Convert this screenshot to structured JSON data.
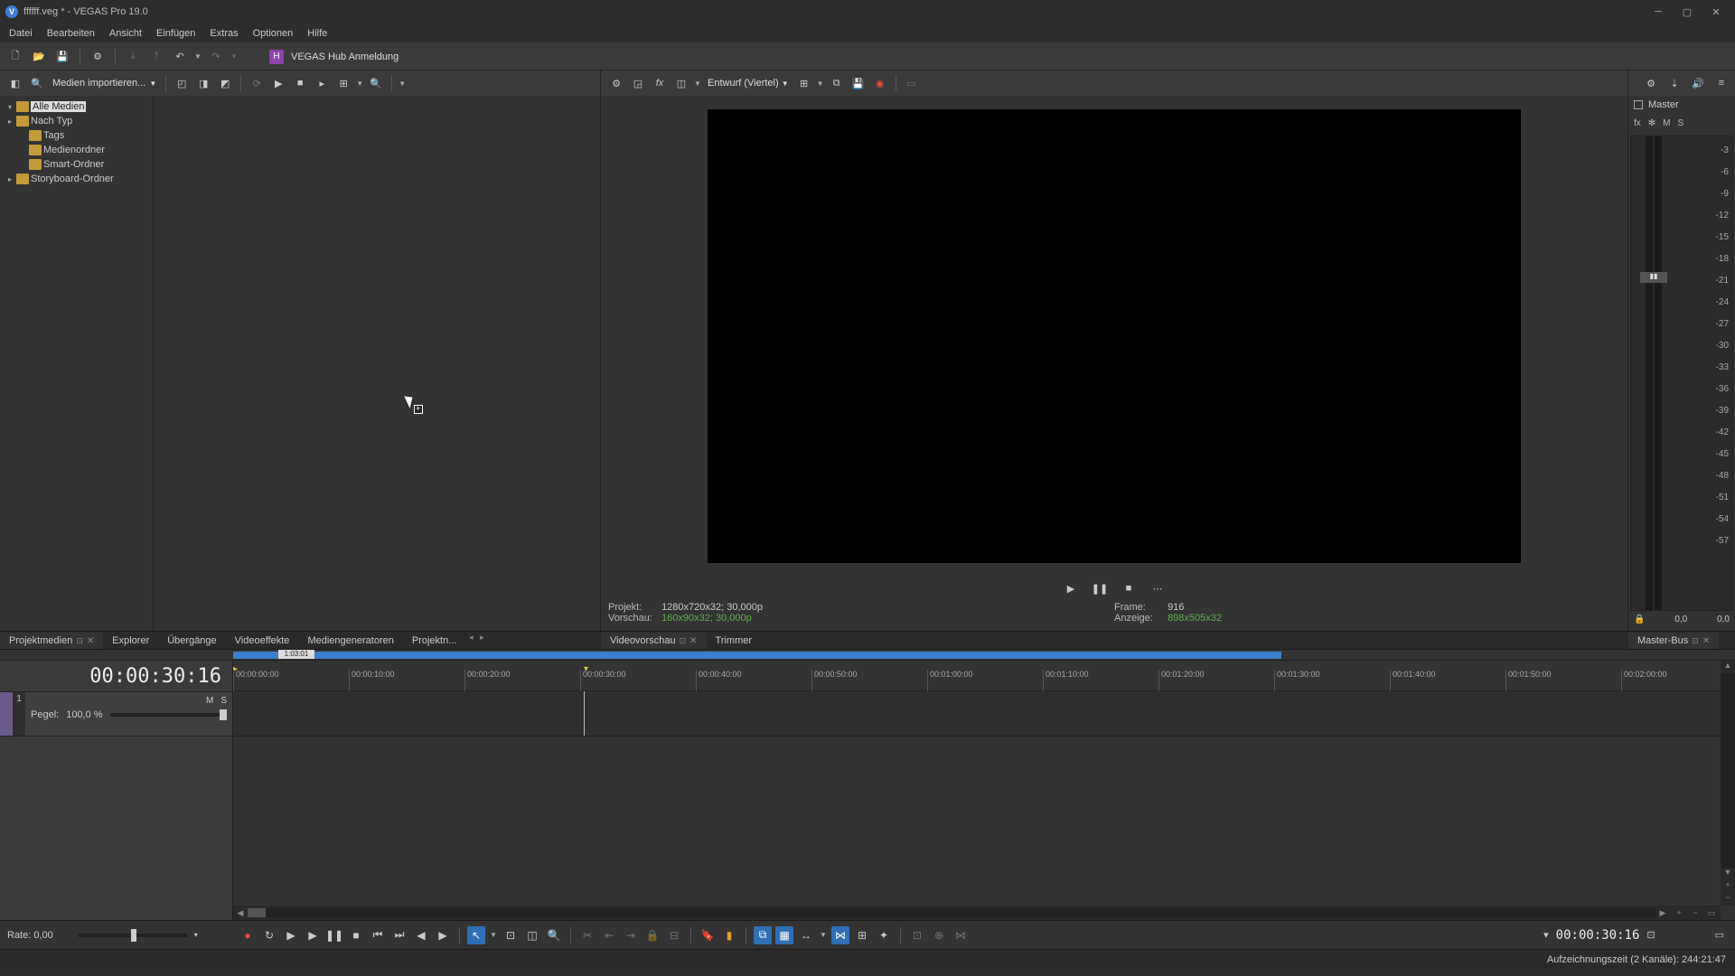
{
  "title": "ffffff.veg * - VEGAS Pro 19.0",
  "menu": [
    "Datei",
    "Bearbeiten",
    "Ansicht",
    "Einfügen",
    "Extras",
    "Optionen",
    "Hilfe"
  ],
  "hub_label": "VEGAS Hub Anmeldung",
  "import_label": "Medien importieren...",
  "tree": {
    "items": [
      {
        "label": "Alle Medien",
        "sel": true,
        "exp": "-"
      },
      {
        "label": "Nach Typ",
        "exp": "+"
      },
      {
        "label": "Tags",
        "exp": "",
        "ind": 1
      },
      {
        "label": "Medienordner",
        "exp": "",
        "ind": 1
      },
      {
        "label": "Smart-Ordner",
        "exp": "",
        "ind": 1
      },
      {
        "label": "Storyboard-Ordner",
        "exp": "+",
        "ind": 0
      }
    ]
  },
  "preview": {
    "quality_label": "Entwurf (Viertel)",
    "project_label": "Projekt:",
    "project_value": "1280x720x32; 30,000p",
    "preview_label": "Vorschau:",
    "preview_value": "160x90x32; 30,000p",
    "frame_label": "Frame:",
    "frame_value": "916",
    "display_label": "Anzeige:",
    "display_value": "898x505x32"
  },
  "master": {
    "title": "Master",
    "ctrl": [
      "fx",
      "✻",
      "M",
      "S"
    ],
    "ticks": [
      "-3",
      "-6",
      "-9",
      "-12",
      "-15",
      "-18",
      "-21",
      "-24",
      "-27",
      "-30",
      "-33",
      "-36",
      "-39",
      "-42",
      "-45",
      "-48",
      "-51",
      "-54",
      "-57"
    ],
    "foot_l": "0,0",
    "foot_r": "0,0",
    "lock": "🔒"
  },
  "tabs_left": [
    "Projektmedien",
    "Explorer",
    "Übergänge",
    "Videoeffekte",
    "Mediengeneratoren",
    "Projektn..."
  ],
  "tabs_mid": [
    "Videovorschau",
    "Trimmer"
  ],
  "tabs_right": [
    "Master-Bus"
  ],
  "timeline": {
    "timecode": "00:00:30:16",
    "marker": "1:03:01",
    "ruler": [
      "00:00:00:00",
      "00:00:10:00",
      "00:00:20:00",
      "00:00:30:00",
      "00:00:40:00",
      "00:00:50:00",
      "00:01:00:00",
      "00:01:10:00",
      "00:01:20:00",
      "00:01:30:00",
      "00:01:40:00",
      "00:01:50:00",
      "00:02:00:00"
    ],
    "track": {
      "num": "1",
      "ms": [
        "M",
        "S"
      ],
      "pegel_label": "Pegel:",
      "pegel_value": "100,0 %"
    }
  },
  "bottom": {
    "rate_label": "Rate:",
    "rate_value": "0,00",
    "timecode": "00:00:30:16"
  },
  "status": "Aufzeichnungszeit (2 Kanäle): 244:21:47"
}
